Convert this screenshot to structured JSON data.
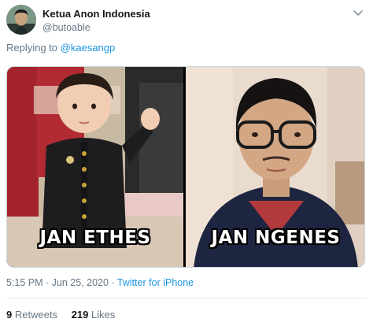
{
  "author": {
    "name": "Ketua Anon Indonesia",
    "handle": "@butoable"
  },
  "reply": {
    "prefix": "Replying to",
    "mention": "@kaesangp"
  },
  "media": {
    "left_caption": "JAN ETHES",
    "right_caption": "JAN NGENES"
  },
  "meta": {
    "timestamp": "5:15 PM · Jun 25, 2020",
    "separator": "·",
    "source": "Twitter for iPhone"
  },
  "stats": {
    "retweets_count": "9",
    "retweets_label": "Retweets",
    "likes_count": "219",
    "likes_label": "Likes"
  },
  "colors": {
    "link": "#1b95e0",
    "secondary_text": "#657786"
  },
  "icons": {
    "menu": "chevron-down-icon"
  }
}
